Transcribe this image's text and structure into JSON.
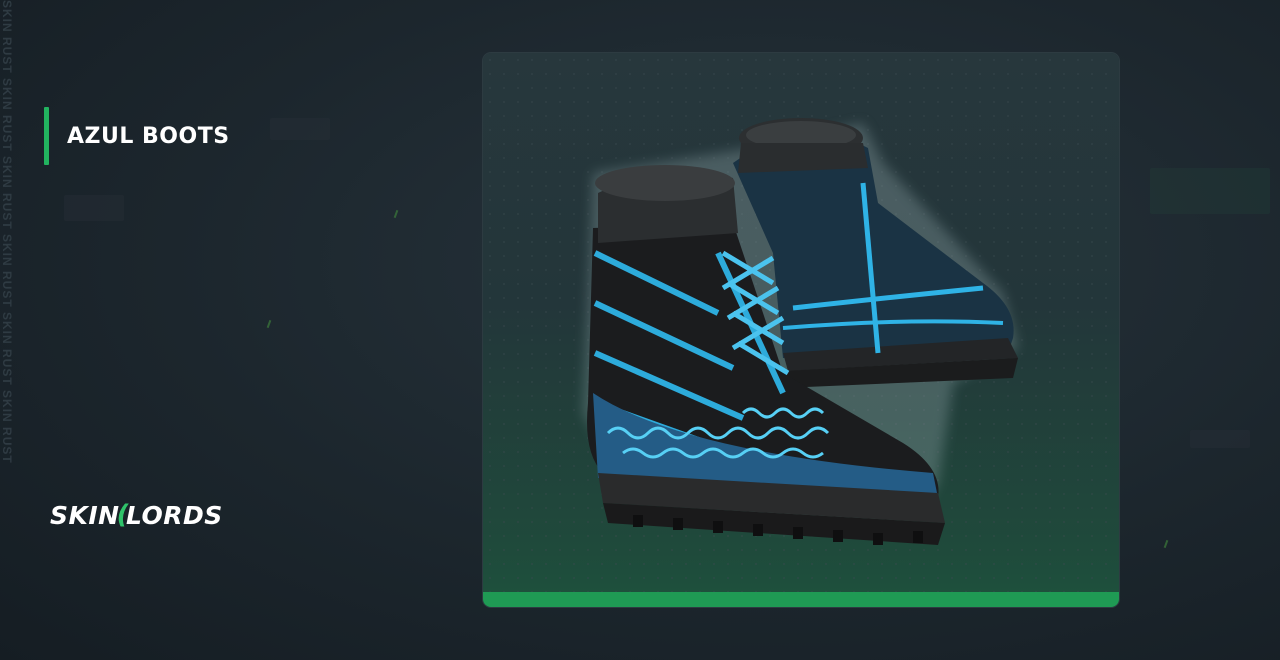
{
  "side_watermark": "SKIN RUST SKIN RUST SKIN RUST SKIN RUST SKIN RUST SKIN RUST",
  "item": {
    "name": "AZUL BOOTS"
  },
  "brand": {
    "left": "SKIN",
    "right": "LORDS",
    "mark": "☠"
  },
  "colors": {
    "accent": "#22b35f",
    "boot_blue": "#2fb3e6",
    "background": "#1c262d"
  },
  "image": {
    "description_icon": "boots-image"
  }
}
